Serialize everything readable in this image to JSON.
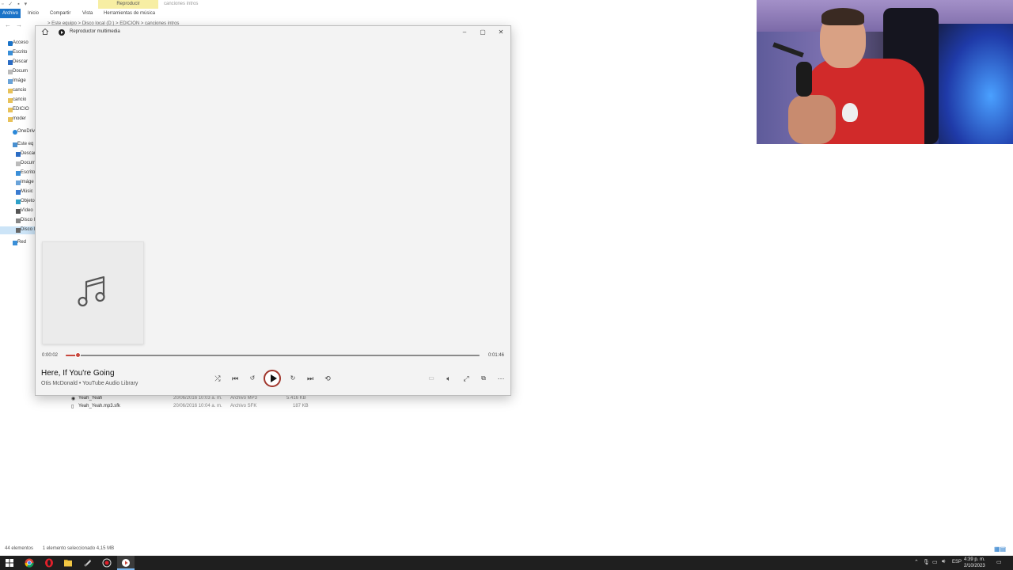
{
  "explorer": {
    "ribbon_context": "Reproducir",
    "folder_title": "canciones intros",
    "tabs": [
      "Archivo",
      "Inicio",
      "Compartir",
      "Vista",
      "Herramientas de música"
    ],
    "breadcrumb": "> Este equipo > Disco local (D:) > EDICION > canciones intros",
    "sidebar": [
      "Acceso",
      "Escrito",
      "Descar",
      "Docum",
      "Imáge",
      "cancio",
      "cancio",
      "EDICIO",
      "moder",
      "OneDriv",
      "Este eq",
      "Descar",
      "Docum",
      "Escrito",
      "Imáge",
      "Músic",
      "Objeto",
      "Vídeo",
      "Disco l",
      "Disco l",
      "Red"
    ],
    "files": [
      {
        "name": "Yeah_Yeah",
        "date": "20/06/2016 10:03 a. m.",
        "type": "Archivo MP3",
        "size": "5.416 KB"
      },
      {
        "name": "Yeah_Yeah.mp3.sfk",
        "date": "20/06/2016 10:04 a. m.",
        "type": "Archivo SFK",
        "size": "187 KB"
      }
    ],
    "status_count": "44 elementos",
    "status_selected": "1 elemento seleccionado 4,15 MB"
  },
  "player": {
    "app_title": "Reproductor multimedia",
    "time_elapsed": "0:00:02",
    "time_total": "0:01:46",
    "progress": 0.028,
    "song_title": "Here, If You're Going",
    "song_artist": "Otis McDonald • YouTube Audio Library",
    "accent_color": "#c8473d",
    "icons": {
      "shuffle": "shuffle-icon",
      "previous": "previous-icon",
      "rewind": "rewind-10-icon",
      "play": "play-icon",
      "forward": "forward-30-icon",
      "next": "next-icon",
      "repeat": "repeat-icon",
      "captions": "captions-icon",
      "volume": "volume-icon",
      "fullscreen": "fullscreen-icon",
      "miniplayer": "miniplayer-icon",
      "more": "more-icon"
    }
  },
  "taskbar": {
    "language": "ESP",
    "time": "4:39 p. m.",
    "date": "2/10/2023"
  }
}
